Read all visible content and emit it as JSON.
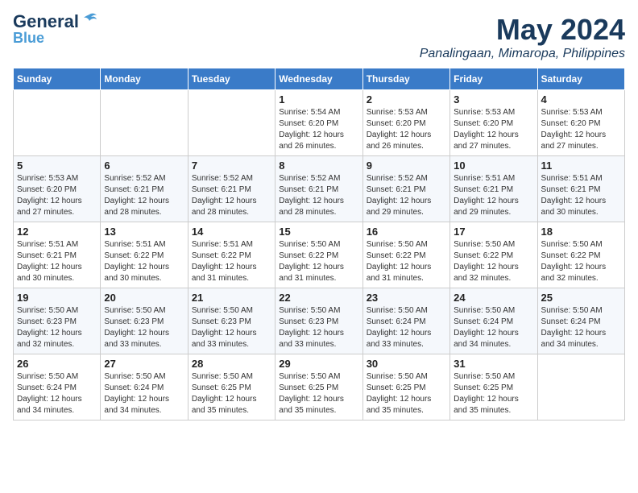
{
  "logo": {
    "general": "General",
    "blue": "Blue"
  },
  "title": {
    "month_year": "May 2024",
    "location": "Panalingaan, Mimaropa, Philippines"
  },
  "headers": [
    "Sunday",
    "Monday",
    "Tuesday",
    "Wednesday",
    "Thursday",
    "Friday",
    "Saturday"
  ],
  "weeks": [
    [
      {
        "day": "",
        "info": ""
      },
      {
        "day": "",
        "info": ""
      },
      {
        "day": "",
        "info": ""
      },
      {
        "day": "1",
        "info": "Sunrise: 5:54 AM\nSunset: 6:20 PM\nDaylight: 12 hours\nand 26 minutes."
      },
      {
        "day": "2",
        "info": "Sunrise: 5:53 AM\nSunset: 6:20 PM\nDaylight: 12 hours\nand 26 minutes."
      },
      {
        "day": "3",
        "info": "Sunrise: 5:53 AM\nSunset: 6:20 PM\nDaylight: 12 hours\nand 27 minutes."
      },
      {
        "day": "4",
        "info": "Sunrise: 5:53 AM\nSunset: 6:20 PM\nDaylight: 12 hours\nand 27 minutes."
      }
    ],
    [
      {
        "day": "5",
        "info": "Sunrise: 5:53 AM\nSunset: 6:20 PM\nDaylight: 12 hours\nand 27 minutes."
      },
      {
        "day": "6",
        "info": "Sunrise: 5:52 AM\nSunset: 6:21 PM\nDaylight: 12 hours\nand 28 minutes."
      },
      {
        "day": "7",
        "info": "Sunrise: 5:52 AM\nSunset: 6:21 PM\nDaylight: 12 hours\nand 28 minutes."
      },
      {
        "day": "8",
        "info": "Sunrise: 5:52 AM\nSunset: 6:21 PM\nDaylight: 12 hours\nand 28 minutes."
      },
      {
        "day": "9",
        "info": "Sunrise: 5:52 AM\nSunset: 6:21 PM\nDaylight: 12 hours\nand 29 minutes."
      },
      {
        "day": "10",
        "info": "Sunrise: 5:51 AM\nSunset: 6:21 PM\nDaylight: 12 hours\nand 29 minutes."
      },
      {
        "day": "11",
        "info": "Sunrise: 5:51 AM\nSunset: 6:21 PM\nDaylight: 12 hours\nand 30 minutes."
      }
    ],
    [
      {
        "day": "12",
        "info": "Sunrise: 5:51 AM\nSunset: 6:21 PM\nDaylight: 12 hours\nand 30 minutes."
      },
      {
        "day": "13",
        "info": "Sunrise: 5:51 AM\nSunset: 6:22 PM\nDaylight: 12 hours\nand 30 minutes."
      },
      {
        "day": "14",
        "info": "Sunrise: 5:51 AM\nSunset: 6:22 PM\nDaylight: 12 hours\nand 31 minutes."
      },
      {
        "day": "15",
        "info": "Sunrise: 5:50 AM\nSunset: 6:22 PM\nDaylight: 12 hours\nand 31 minutes."
      },
      {
        "day": "16",
        "info": "Sunrise: 5:50 AM\nSunset: 6:22 PM\nDaylight: 12 hours\nand 31 minutes."
      },
      {
        "day": "17",
        "info": "Sunrise: 5:50 AM\nSunset: 6:22 PM\nDaylight: 12 hours\nand 32 minutes."
      },
      {
        "day": "18",
        "info": "Sunrise: 5:50 AM\nSunset: 6:22 PM\nDaylight: 12 hours\nand 32 minutes."
      }
    ],
    [
      {
        "day": "19",
        "info": "Sunrise: 5:50 AM\nSunset: 6:23 PM\nDaylight: 12 hours\nand 32 minutes."
      },
      {
        "day": "20",
        "info": "Sunrise: 5:50 AM\nSunset: 6:23 PM\nDaylight: 12 hours\nand 33 minutes."
      },
      {
        "day": "21",
        "info": "Sunrise: 5:50 AM\nSunset: 6:23 PM\nDaylight: 12 hours\nand 33 minutes."
      },
      {
        "day": "22",
        "info": "Sunrise: 5:50 AM\nSunset: 6:23 PM\nDaylight: 12 hours\nand 33 minutes."
      },
      {
        "day": "23",
        "info": "Sunrise: 5:50 AM\nSunset: 6:24 PM\nDaylight: 12 hours\nand 33 minutes."
      },
      {
        "day": "24",
        "info": "Sunrise: 5:50 AM\nSunset: 6:24 PM\nDaylight: 12 hours\nand 34 minutes."
      },
      {
        "day": "25",
        "info": "Sunrise: 5:50 AM\nSunset: 6:24 PM\nDaylight: 12 hours\nand 34 minutes."
      }
    ],
    [
      {
        "day": "26",
        "info": "Sunrise: 5:50 AM\nSunset: 6:24 PM\nDaylight: 12 hours\nand 34 minutes."
      },
      {
        "day": "27",
        "info": "Sunrise: 5:50 AM\nSunset: 6:24 PM\nDaylight: 12 hours\nand 34 minutes."
      },
      {
        "day": "28",
        "info": "Sunrise: 5:50 AM\nSunset: 6:25 PM\nDaylight: 12 hours\nand 35 minutes."
      },
      {
        "day": "29",
        "info": "Sunrise: 5:50 AM\nSunset: 6:25 PM\nDaylight: 12 hours\nand 35 minutes."
      },
      {
        "day": "30",
        "info": "Sunrise: 5:50 AM\nSunset: 6:25 PM\nDaylight: 12 hours\nand 35 minutes."
      },
      {
        "day": "31",
        "info": "Sunrise: 5:50 AM\nSunset: 6:25 PM\nDaylight: 12 hours\nand 35 minutes."
      },
      {
        "day": "",
        "info": ""
      }
    ]
  ]
}
